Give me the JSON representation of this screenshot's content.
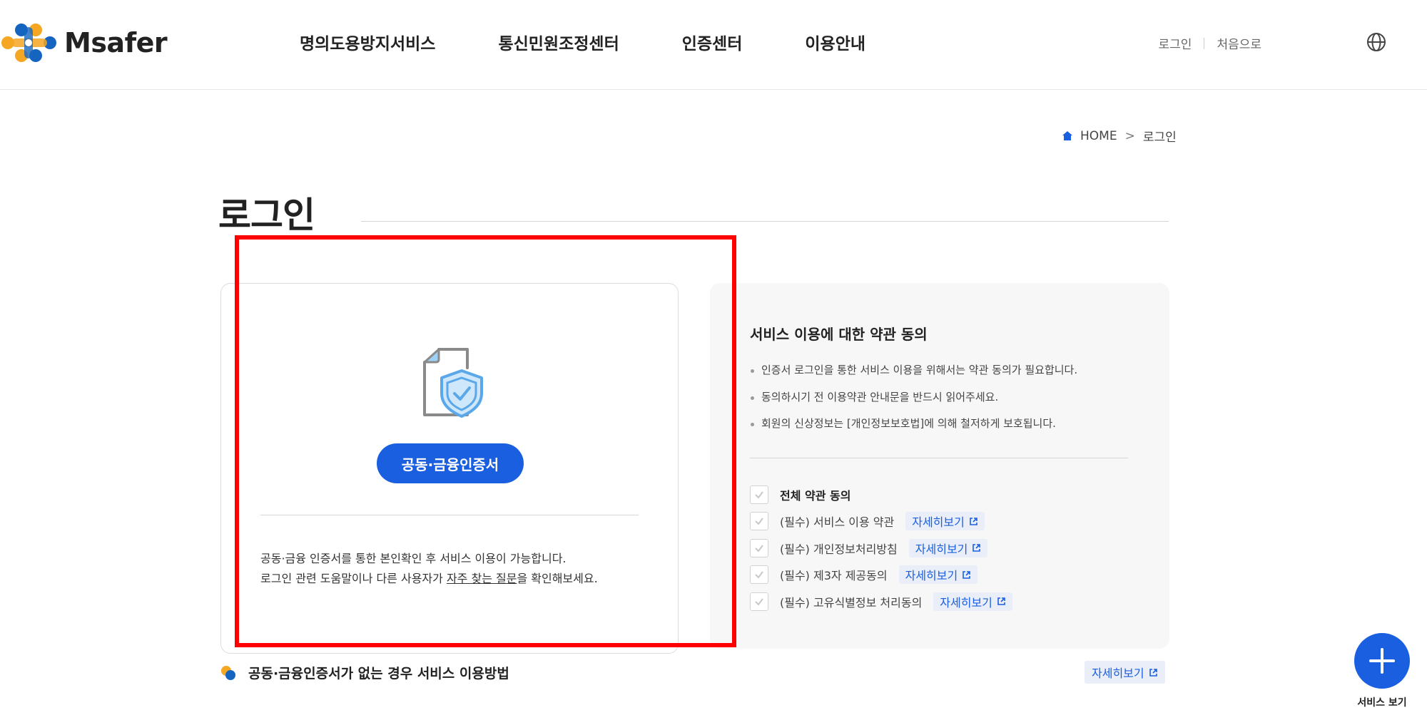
{
  "header": {
    "logo_text": "Msafer",
    "nav": [
      "명의도용방지서비스",
      "통신민원조정센터",
      "인증센터",
      "이용안내"
    ],
    "login": "로그인",
    "home": "처음으로",
    "globe_icon": "globe-icon"
  },
  "breadcrumb": {
    "home": "HOME",
    "current": "로그인"
  },
  "page_title": "로그인",
  "left_card": {
    "icon": "certificate-shield-icon",
    "button": "공동·금융인증서",
    "desc_line1": "공동·금융 인증서를 통한 본인확인 후 서비스 이용이 가능합니다.",
    "desc_line2_pre": "로그인 관련 도움말이나 다른 사용자가 ",
    "desc_line2_link": "자주 찾는 질문",
    "desc_line2_post": "을 확인해보세요."
  },
  "right_card": {
    "title": "서비스 이용에 대한 약관 동의",
    "notes": [
      "인증서 로그인을 통한 서비스 이용을 위해서는 약관 동의가 필요합니다.",
      "동의하시기 전 이용약관 안내문을 반드시 읽어주세요.",
      "회원의 신상정보는 [개인정보보호법]에 의해 철저하게 보호됩니다."
    ],
    "all_agree": "전체 약관 동의",
    "detail_label": "자세히보기",
    "terms": [
      "(필수) 서비스 이용 약관",
      "(필수) 개인정보처리방침",
      "(필수) 제3자 제공동의",
      "(필수) 고유식별정보 처리동의"
    ]
  },
  "bottom": {
    "no_cert_text": "공동·금융인증서가 없는 경우 서비스 이용방법",
    "detail": "자세히보기"
  },
  "fab": {
    "label": "서비스 보기"
  },
  "colors": {
    "primary": "#1a5fe0",
    "highlight": "#ff0000",
    "logo_orange": "#f5a623",
    "logo_blue": "#1565c0"
  }
}
